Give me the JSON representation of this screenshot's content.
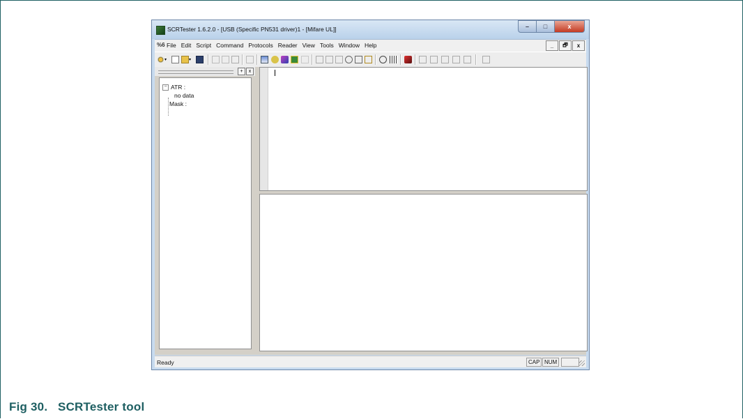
{
  "window": {
    "title": "SCRTester 1.6.2.0 - [USB (Specific PN531 driver)1 - [Mifare UL]]",
    "controls": {
      "minimize": "–",
      "maximize": "□",
      "close": "x"
    }
  },
  "menubar": {
    "system_icon": "%6",
    "items": [
      "File",
      "Edit",
      "Script",
      "Command",
      "Protocols",
      "Reader",
      "View",
      "Tools",
      "Window",
      "Help"
    ],
    "mdi_controls": {
      "minimize": "_",
      "restore": "🗗",
      "close": "x"
    }
  },
  "left_panel": {
    "header_buttons": [
      "+",
      "x"
    ],
    "tree": [
      {
        "label": "ATR :",
        "children": [
          "no data"
        ]
      },
      {
        "label": "Mask :"
      }
    ]
  },
  "statusbar": {
    "status": "Ready",
    "indicators": [
      "CAP",
      "NUM"
    ]
  },
  "caption": {
    "label": "Fig 30.",
    "title": "SCRTester tool"
  },
  "colors": {
    "caption": "#1e5f62",
    "titlebar": "#c8dbef",
    "close_button": "#c43a22"
  }
}
